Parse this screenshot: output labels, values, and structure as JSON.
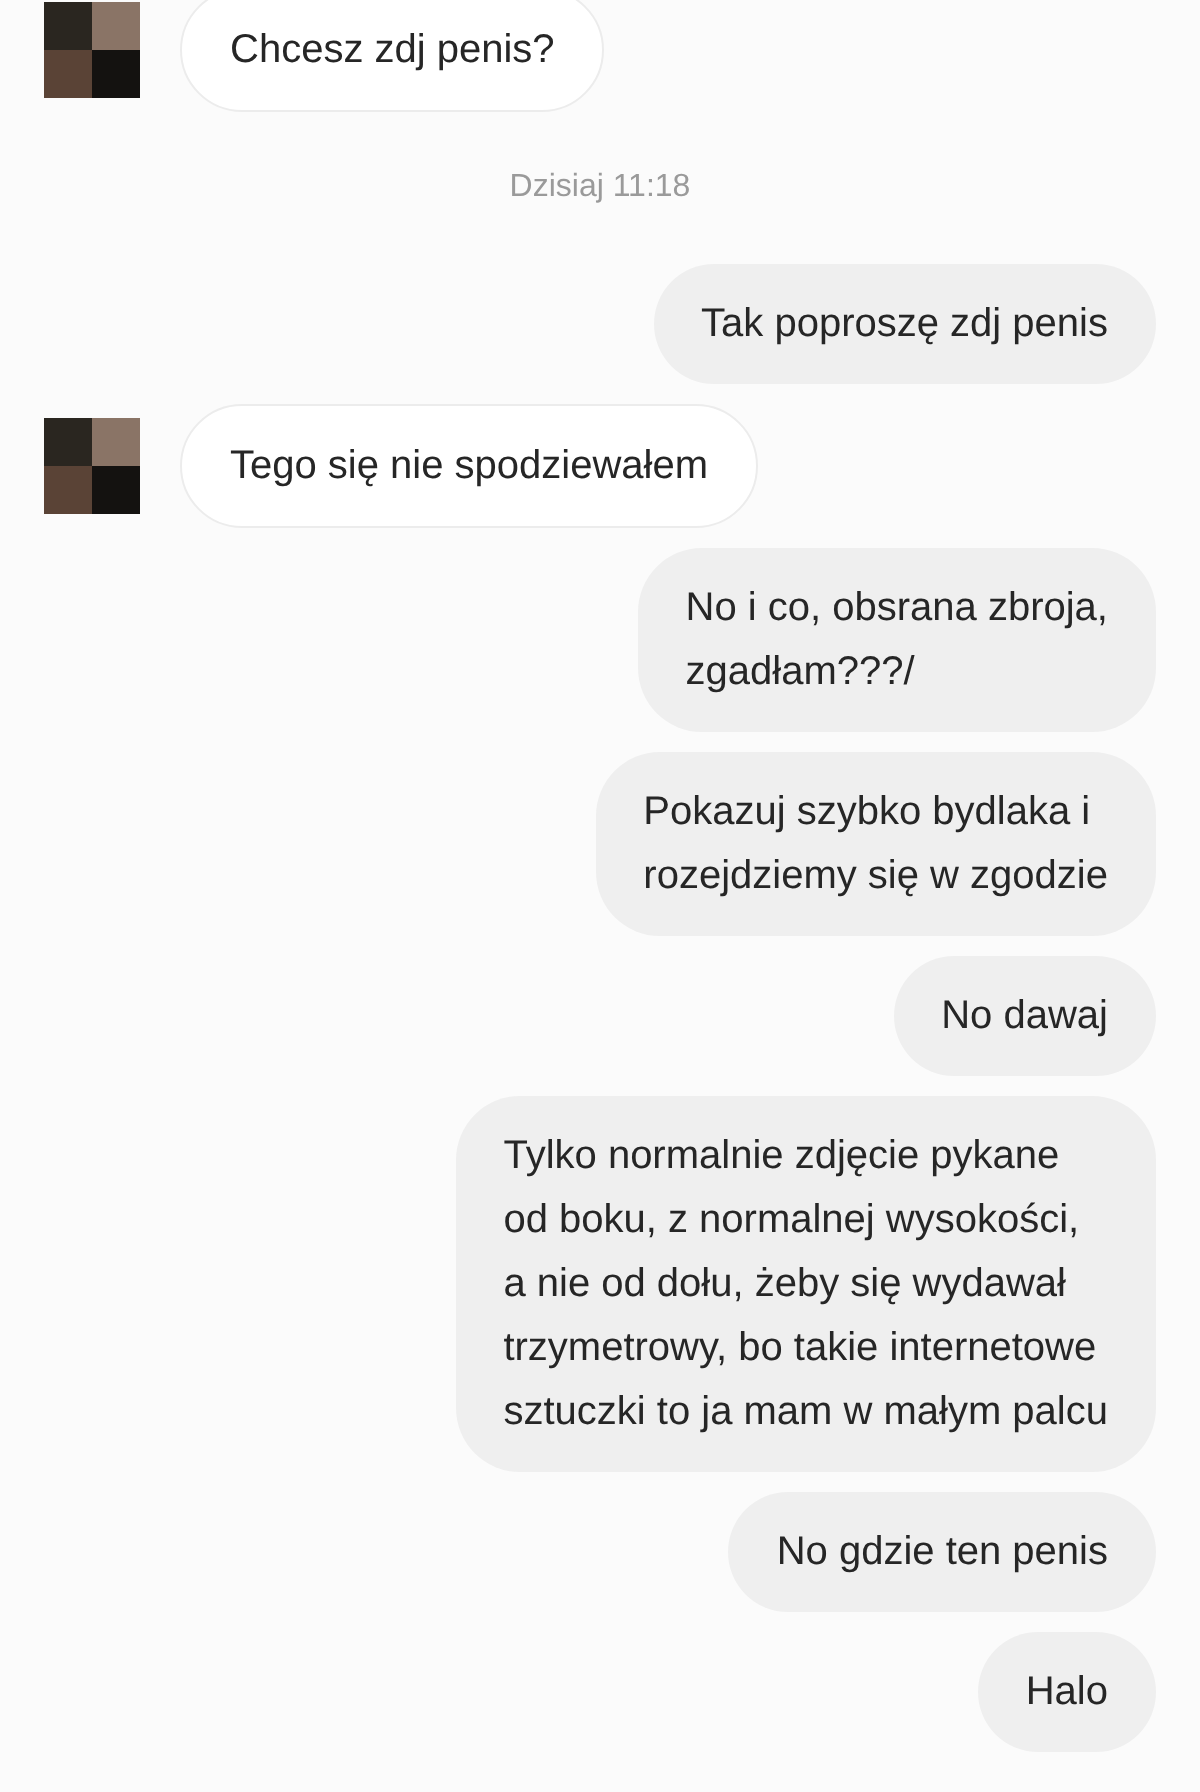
{
  "messages": [
    {
      "kind": "incoming",
      "lines": [
        "Chcesz zdj penis?"
      ]
    },
    {
      "kind": "timestamp",
      "lines": [
        "Dzisiaj 11:18"
      ]
    },
    {
      "kind": "outgoing",
      "lines": [
        "Tak poproszę zdj penis"
      ]
    },
    {
      "kind": "incoming",
      "lines": [
        "Tego się nie spodziewałem"
      ]
    },
    {
      "kind": "outgoing",
      "lines": [
        "No i co, obsrana zbroja,",
        "zgadłam???/"
      ]
    },
    {
      "kind": "outgoing",
      "lines": [
        "Pokazuj szybko bydlaka i",
        "rozejdziemy się w zgodzie"
      ]
    },
    {
      "kind": "outgoing",
      "lines": [
        "No dawaj"
      ]
    },
    {
      "kind": "outgoing",
      "lines": [
        "Tylko normalnie zdjęcie pykane",
        "od boku, z normalnej wysokości,",
        "a nie od dołu, żeby się wydawał",
        "trzymetrowy, bo takie internetowe",
        "sztuczki to ja mam w małym palcu"
      ]
    },
    {
      "kind": "outgoing",
      "lines": [
        "No gdzie ten penis"
      ]
    },
    {
      "kind": "outgoing",
      "lines": [
        "Halo"
      ]
    }
  ]
}
